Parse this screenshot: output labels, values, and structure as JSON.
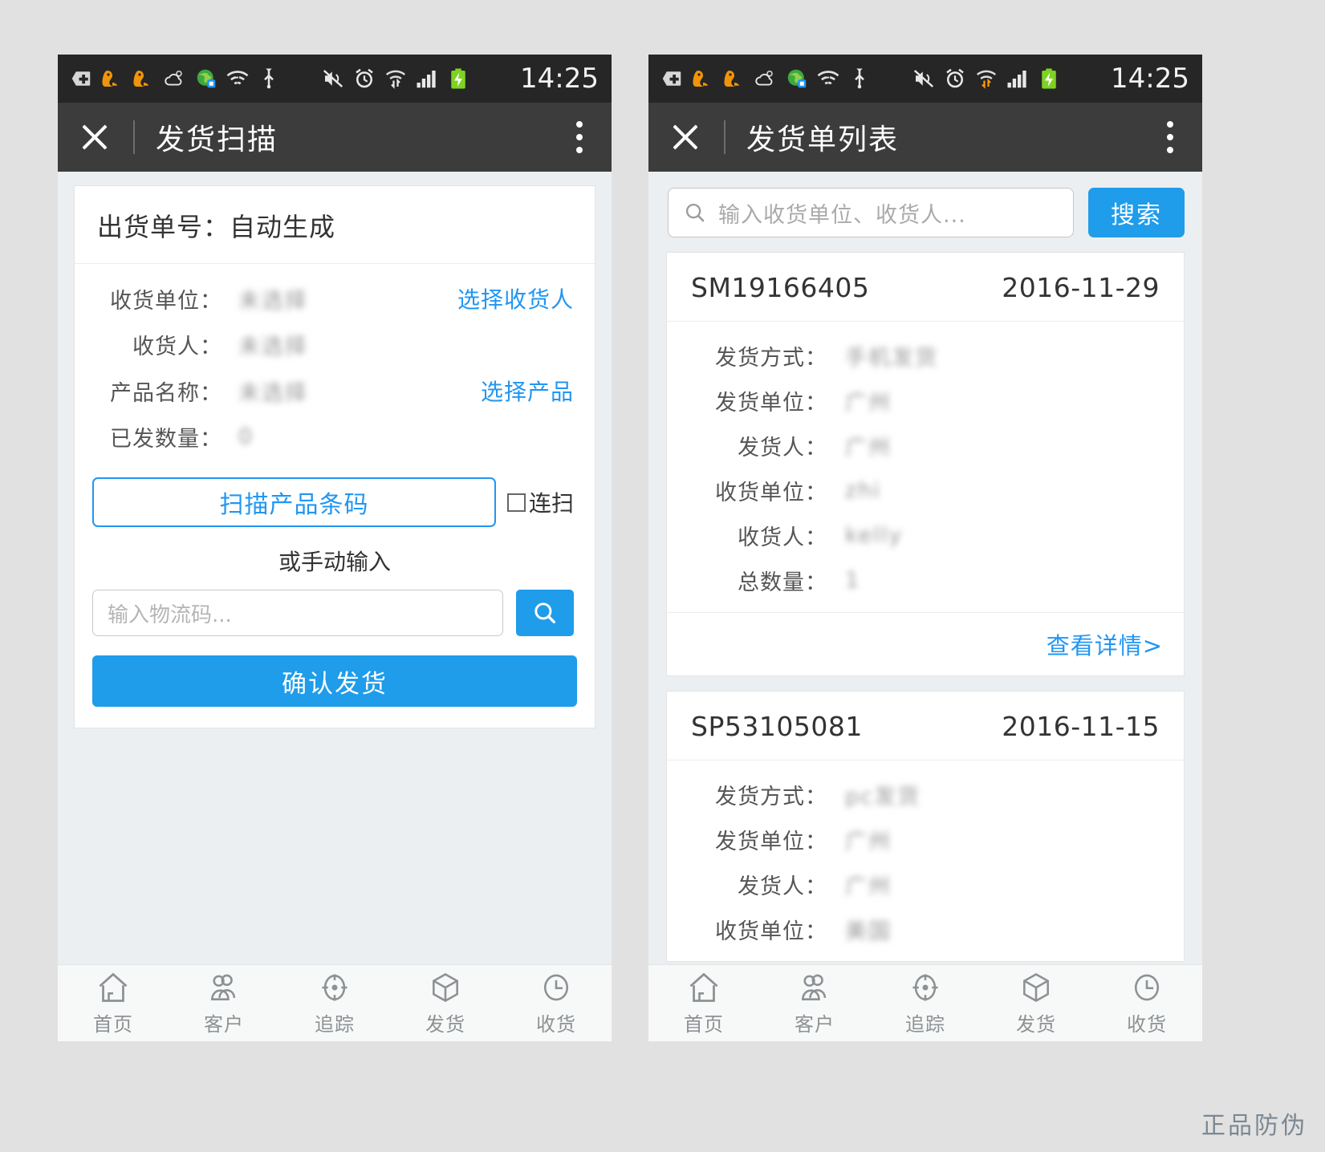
{
  "statusbar": {
    "time": "14:25",
    "icons": [
      "plus-badge-icon",
      "uc-browser-icon",
      "uc-browser-icon",
      "weather-cloud-icon",
      "globe-icon",
      "wifi-question-icon",
      "usb-icon",
      "mute-icon",
      "alarm-icon",
      "data-transfer-icon",
      "signal-bars-icon",
      "battery-charging-icon"
    ]
  },
  "left": {
    "titlebar": {
      "close_icon": "close-icon",
      "title": "发货扫描",
      "more_icon": "more-vertical-icon"
    },
    "card": {
      "header": "出货单号：自动生成",
      "rows": [
        {
          "label": "收货单位：",
          "value": "未选择",
          "action": "选择收货人"
        },
        {
          "label": "收货人：",
          "value": "未选择",
          "action": ""
        },
        {
          "label": "产品名称：",
          "value": "未选择",
          "action": "选择产品"
        },
        {
          "label": "已发数量：",
          "value": "0",
          "action": ""
        }
      ],
      "scan_button": "扫描产品条码",
      "continuous_label": "连扫",
      "continuous_checked": false,
      "or_text": "或手动输入",
      "manual_placeholder": "输入物流码...",
      "manual_value": "",
      "search_icon": "search-icon",
      "confirm_button": "确认发货"
    }
  },
  "right": {
    "titlebar": {
      "close_icon": "close-icon",
      "title": "发货单列表",
      "more_icon": "more-vertical-icon"
    },
    "search": {
      "icon": "search-icon",
      "placeholder": "输入收货单位、收货人...",
      "value": "",
      "button": "搜索"
    },
    "cards": [
      {
        "order_no": "SM19166405",
        "date": "2016-11-29",
        "rows": [
          {
            "label": "发货方式：",
            "value": "手机发货"
          },
          {
            "label": "发货单位：",
            "value": "广州"
          },
          {
            "label": "发货人：",
            "value": "广州"
          },
          {
            "label": "收货单位：",
            "value": "zhi"
          },
          {
            "label": "收货人：",
            "value": "kelly"
          },
          {
            "label": "总数量：",
            "value": "1"
          }
        ],
        "detail_link": "查看详情>"
      },
      {
        "order_no": "SP53105081",
        "date": "2016-11-15",
        "rows": [
          {
            "label": "发货方式：",
            "value": "pc发货"
          },
          {
            "label": "发货单位：",
            "value": "广州"
          },
          {
            "label": "发货人：",
            "value": "广州"
          },
          {
            "label": "收货单位：",
            "value": "美国"
          }
        ],
        "detail_link": ""
      }
    ]
  },
  "tabbar": {
    "items": [
      {
        "icon": "home-icon",
        "label": "首页"
      },
      {
        "icon": "users-icon",
        "label": "客户"
      },
      {
        "icon": "target-icon",
        "label": "追踪"
      },
      {
        "icon": "box-icon",
        "label": "发货"
      },
      {
        "icon": "clock-icon",
        "label": "收货"
      }
    ]
  },
  "watermark": "正品防伪",
  "colors": {
    "accent": "#1f9cea",
    "link": "#2196f3",
    "titlebar": "#3c3c3c",
    "statusbar": "#262626"
  }
}
